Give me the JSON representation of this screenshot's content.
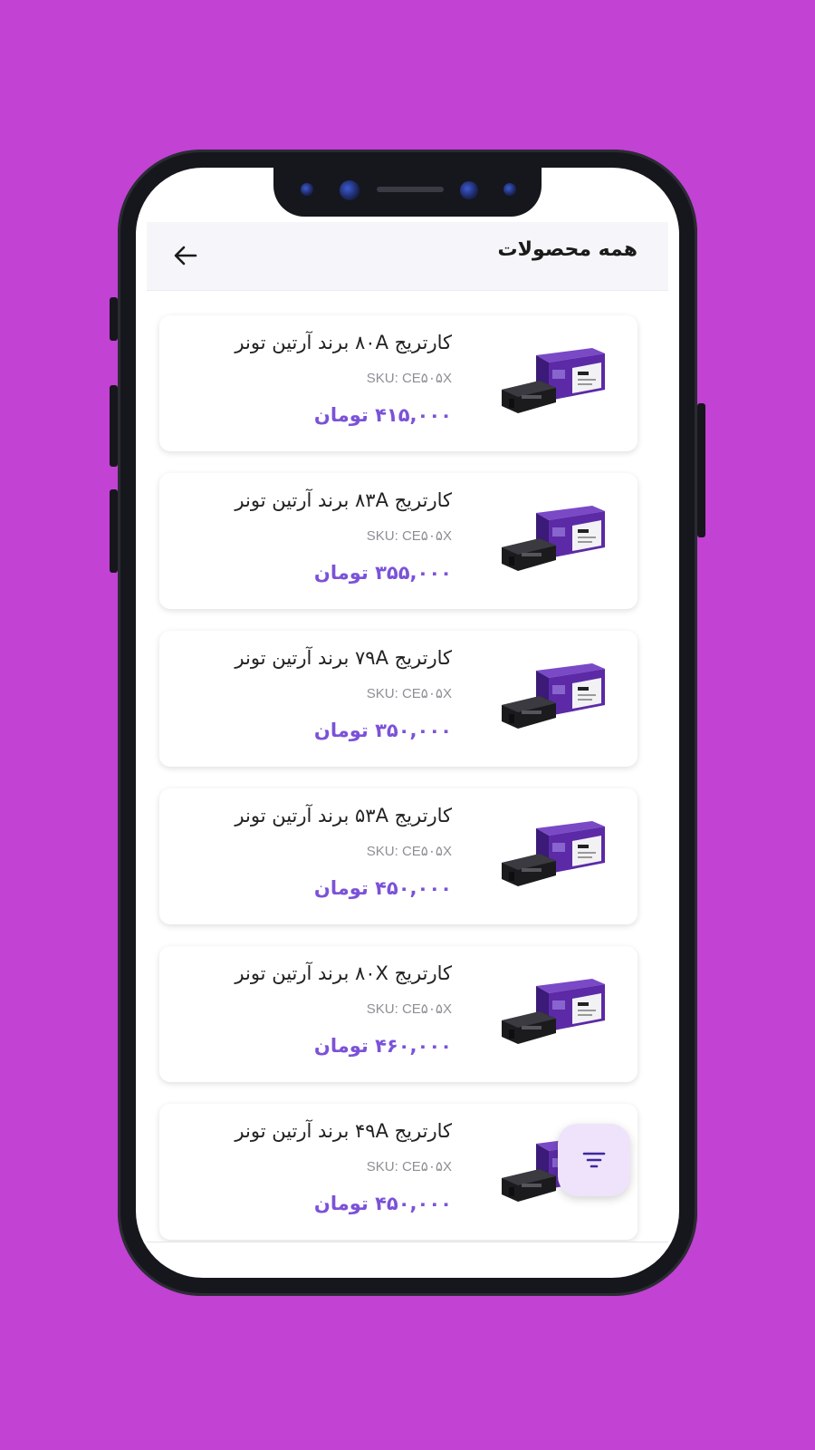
{
  "colors": {
    "background": "#c142d3",
    "price_accent": "#7b52d8",
    "fab_background": "#efe3fb",
    "box_purple": "#5c2aa6"
  },
  "header": {
    "title": "همه محصولات",
    "back_icon": "arrow-left-icon"
  },
  "products": [
    {
      "title": "کارتریج ۸۰A برند آرتین تونر",
      "sku": "SKU: CE۵۰۵X",
      "price": "۴۱۵,۰۰۰ تومان",
      "image_icon": "toner-cartridge-image"
    },
    {
      "title": "کارتریج ۸۳A برند آرتین تونر",
      "sku": "SKU: CE۵۰۵X",
      "price": "۳۵۵,۰۰۰ تومان",
      "image_icon": "toner-cartridge-image"
    },
    {
      "title": "کارتریج ۷۹A برند آرتین تونر",
      "sku": "SKU: CE۵۰۵X",
      "price": "۳۵۰,۰۰۰ تومان",
      "image_icon": "toner-cartridge-image"
    },
    {
      "title": "کارتریج ۵۳A برند آرتین تونر",
      "sku": "SKU: CE۵۰۵X",
      "price": "۴۵۰,۰۰۰ تومان",
      "image_icon": "toner-cartridge-image"
    },
    {
      "title": "کارتریج ۸۰X برند آرتین تونر",
      "sku": "SKU: CE۵۰۵X",
      "price": "۴۶۰,۰۰۰ تومان",
      "image_icon": "toner-cartridge-image"
    },
    {
      "title": "کارتریج ۴۹A برند آرتین تونر",
      "sku": "SKU: CE۵۰۵X",
      "price": "۴۵۰,۰۰۰ تومان",
      "image_icon": "toner-cartridge-image"
    }
  ],
  "fab": {
    "icon": "filter-icon"
  }
}
